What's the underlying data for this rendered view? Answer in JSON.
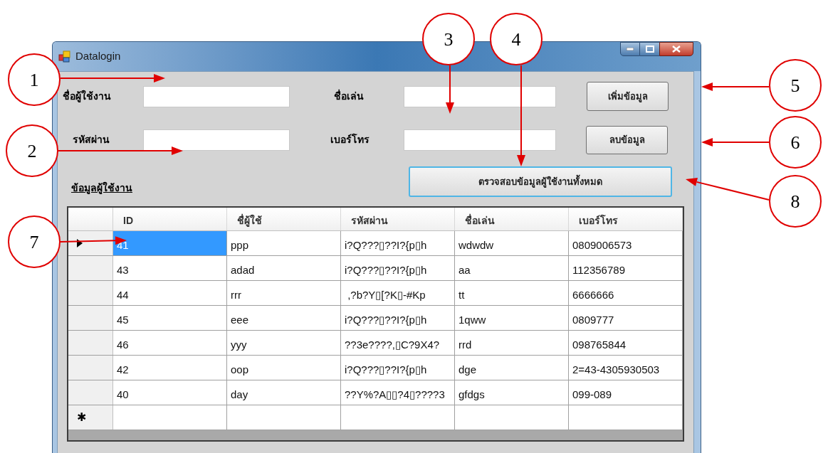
{
  "window": {
    "title": "Datalogin"
  },
  "fields": [
    {
      "label": "ชื่อผู้ใช้งาน"
    },
    {
      "label": "ชื่อเล่น"
    },
    {
      "label": "รหัสผ่าน"
    },
    {
      "label": "เบอร์โทร"
    }
  ],
  "buttons": [
    {
      "label": "เพิ่มข้อมูล",
      "focused": false
    },
    {
      "label": "ลบข้อมูล",
      "focused": false
    },
    {
      "label": "ตรวจสอบข้อมูลผู้ใช้งานทั้งหมด",
      "focused": true
    }
  ],
  "section_label": "ข้อมูลผู้ใช้งาน",
  "table": {
    "columns": [
      "ID",
      "ชื่ผู้ใช้",
      "รหัสผ่าน",
      "ชื่อเล่น",
      "เบอร์โทร"
    ],
    "rows": [
      {
        "selected": true,
        "cells": [
          "41",
          "ppp",
          "i?Q???▯??I?{p▯h",
          "wdwdw",
          "0809006573"
        ]
      },
      {
        "selected": false,
        "cells": [
          "43",
          "adad",
          "i?Q???▯??I?{p▯h",
          "aa",
          "112356789"
        ]
      },
      {
        "selected": false,
        "cells": [
          "44",
          "rrr",
          " ,?b?Y▯[?K▯-#Kp",
          "tt",
          "6666666"
        ]
      },
      {
        "selected": false,
        "cells": [
          "45",
          "eee",
          "i?Q???▯??I?{p▯h",
          "1qww",
          "0809777"
        ]
      },
      {
        "selected": false,
        "cells": [
          "46",
          "yyy",
          "??3e????,▯C?9X4?",
          "rrd",
          "098765844"
        ]
      },
      {
        "selected": false,
        "cells": [
          "42",
          "oop",
          "i?Q???▯??I?{p▯h",
          "dge",
          "2=43-4305930503"
        ]
      },
      {
        "selected": false,
        "cells": [
          "40",
          "day",
          "??Y%?A▯▯?4▯????3",
          "gfdgs",
          "099-089"
        ]
      }
    ],
    "new_row_marker": "✱"
  },
  "callouts": [
    {
      "number": "1"
    },
    {
      "number": "2"
    },
    {
      "number": "3"
    },
    {
      "number": "4"
    },
    {
      "number": "5"
    },
    {
      "number": "6"
    },
    {
      "number": "7"
    },
    {
      "number": "8"
    }
  ]
}
